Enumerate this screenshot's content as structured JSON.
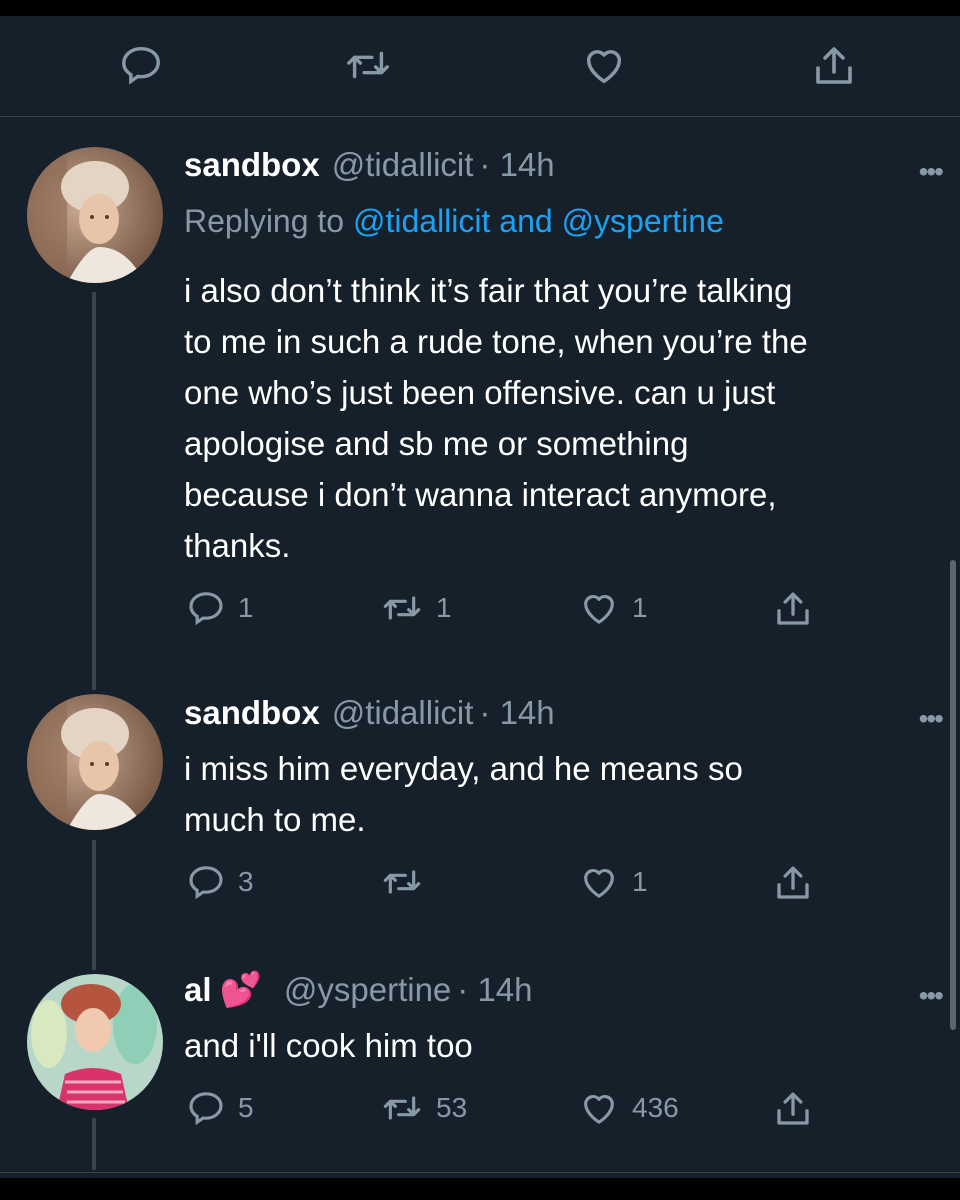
{
  "colors": {
    "background": "#15202b",
    "text": "#ffffff",
    "muted": "#8899a6",
    "link": "#1da1f2",
    "heart_emoji": "#e8308c"
  },
  "top_actions": [
    {
      "icon": "reply-icon"
    },
    {
      "icon": "retweet-icon"
    },
    {
      "icon": "like-icon"
    },
    {
      "icon": "share-icon"
    }
  ],
  "tweets": [
    {
      "name": "sandbox",
      "handle": "@tidallicit",
      "time": "· 14h",
      "replying_prefix": "Replying to ",
      "replying_mentions": "@tidallicit and @yspertine",
      "lines": [
        "i also don’t think it’s fair that you’re talking",
        "to me in such a rude tone, when you’re the",
        "one who’s just been offensive. can u just",
        "apologise and sb me or something",
        "because i don’t wanna interact anymore,",
        "thanks."
      ],
      "replies": "1",
      "retweets": "1",
      "likes": "1"
    },
    {
      "name": "sandbox",
      "handle": "@tidallicit",
      "time": "· 14h",
      "lines": [
        "i miss him everyday, and he means so",
        "much to me."
      ],
      "replies": "3",
      "retweets": "",
      "likes": "1"
    },
    {
      "name": "al",
      "name_emoji": "💕",
      "handle": "@yspertine",
      "time": "· 14h",
      "lines": [
        "and i'll cook him too"
      ],
      "replies": "5",
      "retweets": "53",
      "likes": "436"
    }
  ],
  "more_label": "•••"
}
